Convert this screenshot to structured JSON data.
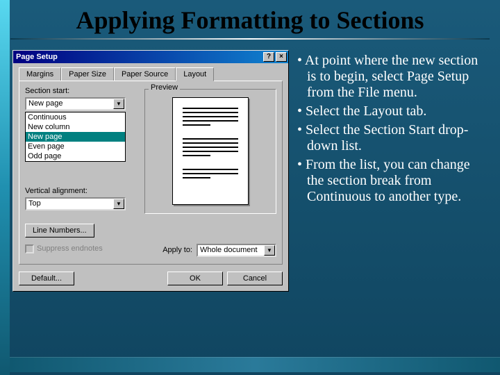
{
  "slide": {
    "title": "Applying Formatting to Sections"
  },
  "dialog": {
    "title": "Page Setup",
    "help_btn": "?",
    "close_btn": "×",
    "tabs": {
      "margins": "Margins",
      "paper_size": "Paper Size",
      "paper_source": "Paper Source",
      "layout": "Layout"
    },
    "section_start_label": "Section start:",
    "section_start_value": "New page",
    "section_start_options": [
      "Continuous",
      "New column",
      "New page",
      "Even page",
      "Odd page"
    ],
    "vertical_alignment_label": "Vertical alignment:",
    "vertical_alignment_value": "Top",
    "line_numbers_btn": "Line Numbers...",
    "suppress_endnotes": "Suppress endnotes",
    "preview_label": "Preview",
    "apply_to_label": "Apply to:",
    "apply_to_value": "Whole document",
    "default_btn": "Default...",
    "ok_btn": "OK",
    "cancel_btn": "Cancel"
  },
  "bullets": [
    "At point where the new section is to begin, select Page Setup from the File menu.",
    "Select the Layout tab.",
    "Select the Section Start drop-down list.",
    "From the list, you can change the section break from Continuous to another type."
  ]
}
